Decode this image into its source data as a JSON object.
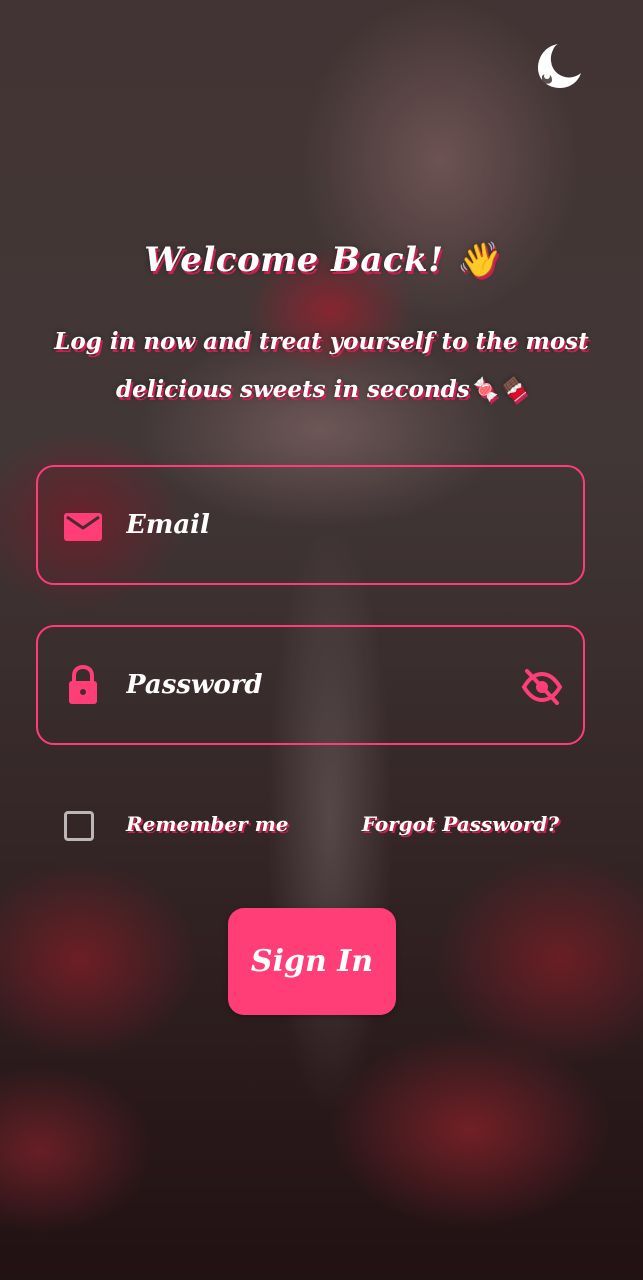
{
  "login": {
    "title": "Welcome Back! 👋",
    "subtitle": "Log in now and treat yourself to the most delicious sweets in seconds🍬🍫",
    "email_placeholder": "Email",
    "password_placeholder": "Password",
    "remember_label": "Remember me",
    "forgot_label": "Forgot Password?",
    "signin_label": "Sign In"
  },
  "icons": {
    "logo": "moon-logo-icon",
    "email": "mail-icon",
    "password": "lock-icon",
    "visibility": "eye-off-icon"
  },
  "colors": {
    "accent": "#ff3e78",
    "text": "#ffffff",
    "text_shadow": "#c8204f"
  }
}
